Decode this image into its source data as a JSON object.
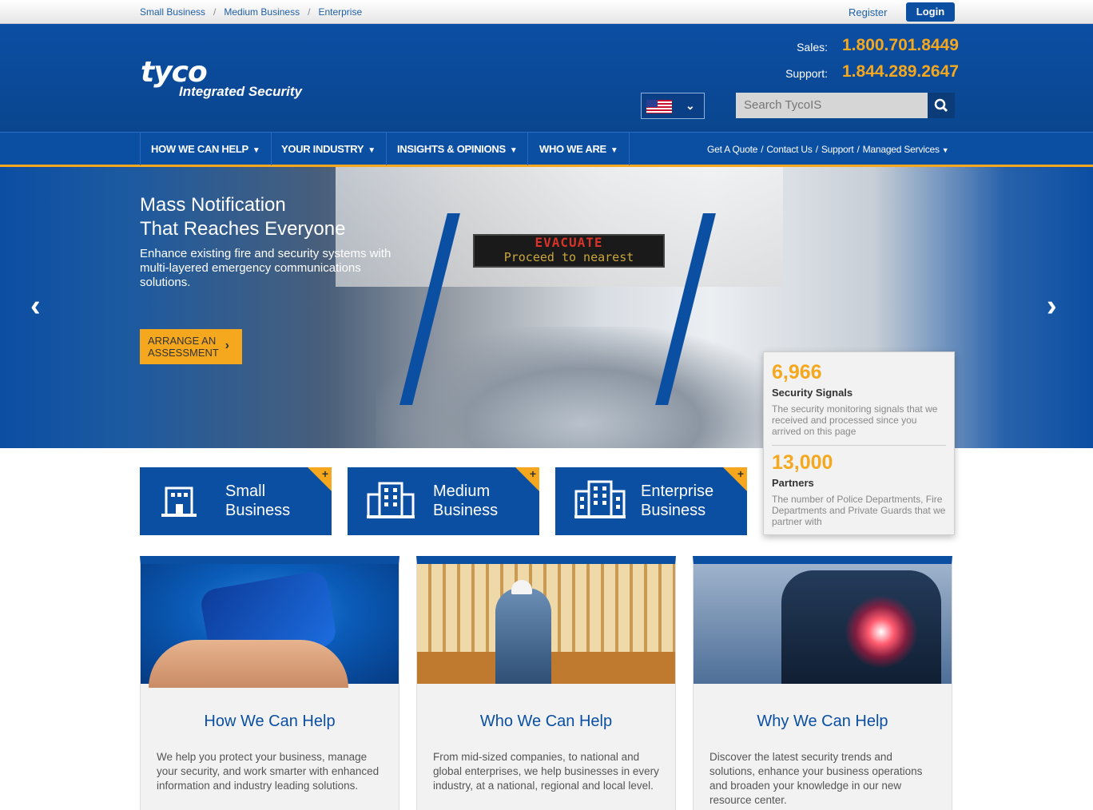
{
  "topbar": {
    "crumbs": [
      "Small Business",
      "Medium Business",
      "Enterprise"
    ],
    "register": "Register",
    "login": "Login"
  },
  "header": {
    "logo": "tyco",
    "logo_sub": "Integrated Security",
    "sales_label": "Sales:",
    "sales_number": "1.800.701.8449",
    "support_label": "Support:",
    "support_number": "1.844.289.2647",
    "search_placeholder": "Search TycoIS"
  },
  "nav": {
    "items": [
      "HOW WE CAN HELP",
      "YOUR INDUSTRY",
      "INSIGHTS & OPINIONS",
      "WHO WE ARE"
    ],
    "utility": [
      "Get A Quote",
      "Contact Us",
      "Support",
      "Managed Services"
    ]
  },
  "hero": {
    "title_line1": "Mass Notification",
    "title_line2": "That Reaches Everyone",
    "description": "Enhance existing fire and security systems with multi-layered emergency communications solutions.",
    "cta_line1": "ARRANGE AN",
    "cta_line2": "ASSESSMENT",
    "sign_line1": "EVACUATE",
    "sign_line2": "Proceed to nearest"
  },
  "stats": [
    {
      "number": "6,966",
      "title": "Security Signals",
      "desc": "The security monitoring signals that we received and processed since you arrived on this page"
    },
    {
      "number": "13,000",
      "title": "Partners",
      "desc": "The number of Police Departments, Fire Departments and Private Guards that we partner with"
    }
  ],
  "tiles": [
    {
      "line1": "Small",
      "line2": "Business"
    },
    {
      "line1": "Medium",
      "line2": "Business"
    },
    {
      "line1": "Enterprise",
      "line2": "Business"
    }
  ],
  "cards": [
    {
      "title": "How We Can Help",
      "desc": "We help you protect your business, manage your security, and work smarter with enhanced information and industry leading solutions."
    },
    {
      "title": "Who We Can Help",
      "desc": "From mid-sized companies, to national and global enterprises, we help businesses in every industry, at a national, regional and local level."
    },
    {
      "title": "Why We Can Help",
      "desc": "Discover the latest security trends and solutions, enhance your business operations and broaden your knowledge in our new resource center."
    }
  ],
  "colors": {
    "brand_blue": "#0b4fa3",
    "accent_orange": "#f5a81e"
  }
}
